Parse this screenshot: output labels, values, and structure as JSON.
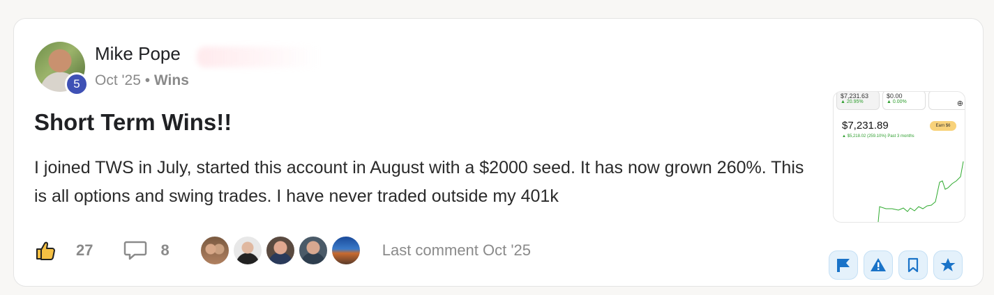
{
  "post": {
    "author": "Mike Pope",
    "level": "5",
    "date": "Oct '25",
    "separator": "•",
    "category": "Wins",
    "title": "Short Term Wins!!",
    "body": "I joined TWS in July, started this account in August with a $2000 seed. It has now grown 260%. This is all options and swing trades. I have never traded outside my 401k"
  },
  "thumbnail": {
    "tab1_value": "$7,231.63",
    "tab1_change": "▲ 20.95%",
    "tab2_value": "$0.00",
    "tab2_change": "▲ 0.00%",
    "plus": "⊕",
    "balance": "$7,231.89",
    "change": "▲ $5,218.02 (259.10%) Past 3 months",
    "pill": "Earn $6"
  },
  "footer": {
    "likes": "27",
    "comments": "8",
    "last_comment": "Last comment Oct '25"
  },
  "icons": {
    "like": "thumbs-up-icon",
    "comment": "speech-bubble-icon",
    "flag": "flag-icon",
    "report": "warning-icon",
    "bookmark": "bookmark-icon",
    "favorite": "star-icon"
  },
  "colors": {
    "accent_blue": "#1a73c8",
    "badge": "#3f51b5",
    "action_bg": "#e4f1fb",
    "like_yellow": "#f5c043"
  }
}
